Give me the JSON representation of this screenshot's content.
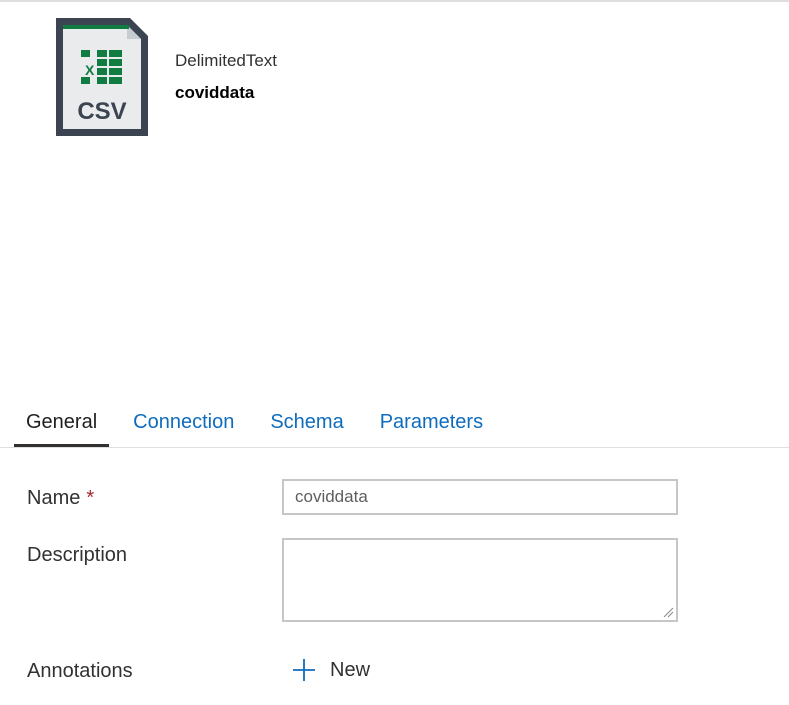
{
  "dataset": {
    "icon_name": "csv-file-icon",
    "icon_text": "CSV",
    "type_label": "DelimitedText",
    "name": "coviddata"
  },
  "tabs": [
    {
      "label": "General",
      "active": true
    },
    {
      "label": "Connection",
      "active": false
    },
    {
      "label": "Schema",
      "active": false
    },
    {
      "label": "Parameters",
      "active": false
    }
  ],
  "form": {
    "name_label": "Name",
    "required_marker": "*",
    "name_value": "coviddata",
    "description_label": "Description",
    "description_value": "",
    "annotations_label": "Annotations",
    "new_button_label": "New"
  },
  "colors": {
    "link_blue": "#0f6cbd",
    "excel_green": "#107c41",
    "required_red": "#a4262c",
    "icon_frame": "#3b4450"
  }
}
